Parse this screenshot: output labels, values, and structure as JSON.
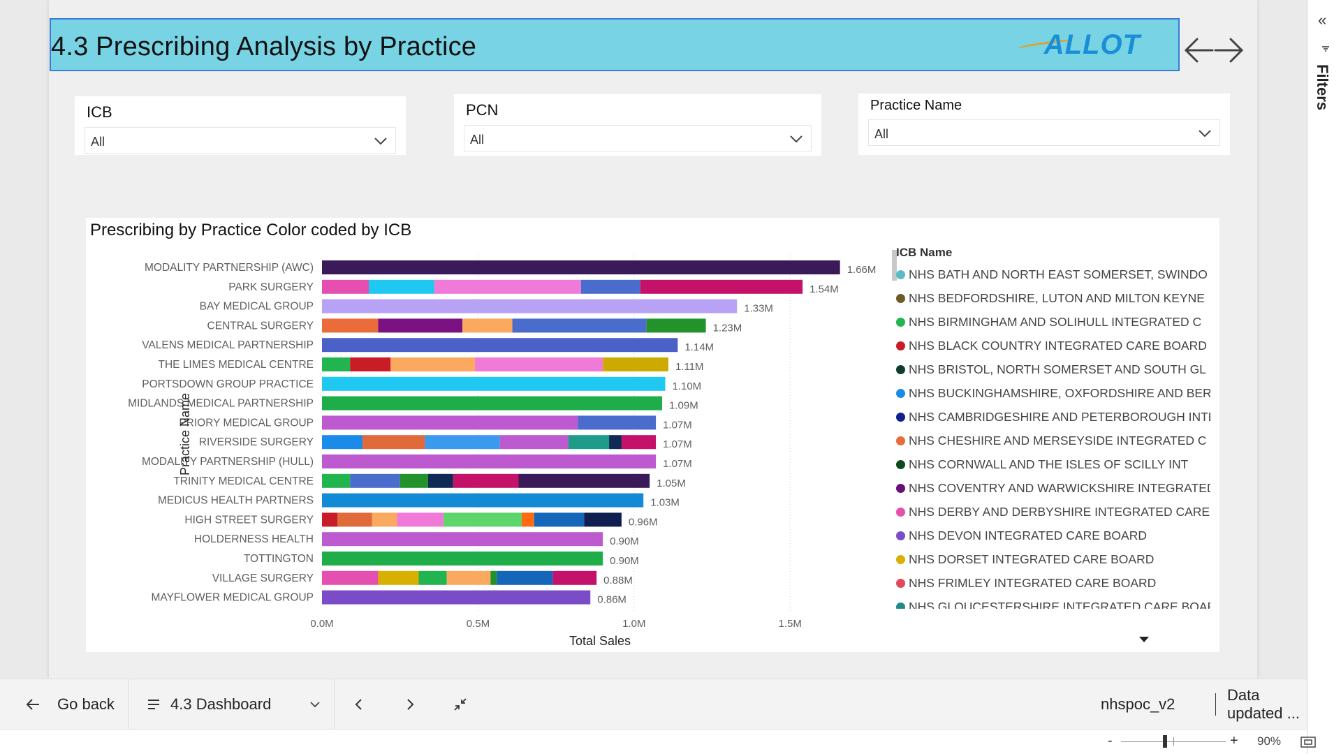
{
  "page_title": "4.3 Prescribing Analysis by Practice",
  "logo_text": "ALLOT",
  "slicers": [
    {
      "label": "ICB",
      "value": "All"
    },
    {
      "label": "PCN",
      "value": "All"
    },
    {
      "label": "Practice Name",
      "value": "All"
    }
  ],
  "chart_data": {
    "type": "bar",
    "orientation": "horizontal",
    "stacked": true,
    "title": "Prescribing by Practice Color coded by ICB",
    "xlabel": "Total Sales",
    "ylabel": "Practice Name",
    "xlim": [
      0,
      1.66
    ],
    "x_ticks": [
      "0.0M",
      "0.5M",
      "1.0M",
      "1.5M"
    ],
    "x_tick_values": [
      0,
      0.5,
      1.0,
      1.5
    ],
    "units": "M",
    "legend_title": "ICB Name",
    "legend_position": "right",
    "bars": [
      {
        "name": "MODALITY PARTNERSHIP (AWC)",
        "total": 1.66,
        "label": "1.66M",
        "segments": [
          {
            "color": "#3b1a5a",
            "value": 1.66
          }
        ]
      },
      {
        "name": "PARK SURGERY",
        "total": 1.54,
        "label": "1.54M",
        "segments": [
          {
            "color": "#e44fb0",
            "value": 0.15
          },
          {
            "color": "#1ec8f0",
            "value": 0.21
          },
          {
            "color": "#f07ad8",
            "value": 0.47
          },
          {
            "color": "#4a6ccc",
            "value": 0.19
          },
          {
            "color": "#c4126a",
            "value": 0.52
          }
        ]
      },
      {
        "name": "BAY MEDICAL GROUP",
        "total": 1.33,
        "label": "1.33M",
        "segments": [
          {
            "color": "#b7a2f6",
            "value": 1.33
          }
        ]
      },
      {
        "name": "CENTRAL SURGERY",
        "total": 1.23,
        "label": "1.23M",
        "segments": [
          {
            "color": "#ea6c3a",
            "value": 0.18
          },
          {
            "color": "#7a1282",
            "value": 0.27
          },
          {
            "color": "#fba95e",
            "value": 0.16
          },
          {
            "color": "#4a6ccc",
            "value": 0.43
          },
          {
            "color": "#24922a",
            "value": 0.19
          }
        ]
      },
      {
        "name": "VALENS MEDICAL PARTNERSHIP",
        "total": 1.14,
        "label": "1.14M",
        "segments": [
          {
            "color": "#4a62c8",
            "value": 1.14
          }
        ]
      },
      {
        "name": "THE LIMES MEDICAL CENTRE",
        "total": 1.11,
        "label": "1.11M",
        "segments": [
          {
            "color": "#22b44e",
            "value": 0.09
          },
          {
            "color": "#c81c26",
            "value": 0.13
          },
          {
            "color": "#fba95e",
            "value": 0.27
          },
          {
            "color": "#f07ad8",
            "value": 0.41
          },
          {
            "color": "#ccaa00",
            "value": 0.21
          }
        ]
      },
      {
        "name": "PORTSDOWN GROUP PRACTICE",
        "total": 1.1,
        "label": "1.10M",
        "segments": [
          {
            "color": "#1ec8f0",
            "value": 1.1
          }
        ]
      },
      {
        "name": "MIDLANDS MEDICAL PARTNERSHIP",
        "total": 1.09,
        "label": "1.09M",
        "segments": [
          {
            "color": "#1fad4a",
            "value": 1.09
          }
        ]
      },
      {
        "name": "PRIORY MEDICAL GROUP",
        "total": 1.07,
        "label": "1.07M",
        "segments": [
          {
            "color": "#bd5ad0",
            "value": 0.82
          },
          {
            "color": "#4a6ccc",
            "value": 0.25
          }
        ]
      },
      {
        "name": "RIVERSIDE SURGERY",
        "total": 1.07,
        "label": "1.07M",
        "segments": [
          {
            "color": "#1b8bea",
            "value": 0.13
          },
          {
            "color": "#e06a3a",
            "value": 0.2
          },
          {
            "color": "#3a9af0",
            "value": 0.24
          },
          {
            "color": "#bd5ad0",
            "value": 0.22
          },
          {
            "color": "#1f9b8a",
            "value": 0.13
          },
          {
            "color": "#0e2a55",
            "value": 0.04
          },
          {
            "color": "#c4126a",
            "value": 0.11
          }
        ]
      },
      {
        "name": "MODALITY PARTNERSHIP (HULL)",
        "total": 1.07,
        "label": "1.07M",
        "segments": [
          {
            "color": "#bd5ad0",
            "value": 1.07
          }
        ]
      },
      {
        "name": "TRINITY MEDICAL CENTRE",
        "total": 1.05,
        "label": "1.05M",
        "segments": [
          {
            "color": "#22b44e",
            "value": 0.09
          },
          {
            "color": "#4a6ccc",
            "value": 0.16
          },
          {
            "color": "#24922a",
            "value": 0.09
          },
          {
            "color": "#0e2a55",
            "value": 0.08
          },
          {
            "color": "#c4126a",
            "value": 0.21
          },
          {
            "color": "#3b1a5a",
            "value": 0.42
          }
        ]
      },
      {
        "name": "MEDICUS HEALTH PARTNERS",
        "total": 1.03,
        "label": "1.03M",
        "segments": [
          {
            "color": "#128ad6",
            "value": 1.03
          }
        ]
      },
      {
        "name": "HIGH STREET SURGERY",
        "total": 0.96,
        "label": "0.96M",
        "segments": [
          {
            "color": "#c81c26",
            "value": 0.05
          },
          {
            "color": "#e06a3a",
            "value": 0.11
          },
          {
            "color": "#fba95e",
            "value": 0.08
          },
          {
            "color": "#f07ad8",
            "value": 0.15
          },
          {
            "color": "#5cd66a",
            "value": 0.25
          },
          {
            "color": "#ff6a10",
            "value": 0.04
          },
          {
            "color": "#1466b8",
            "value": 0.16
          },
          {
            "color": "#0e1f50",
            "value": 0.12
          }
        ]
      },
      {
        "name": "HOLDERNESS HEALTH",
        "total": 0.9,
        "label": "0.90M",
        "segments": [
          {
            "color": "#bd5ad0",
            "value": 0.9
          }
        ]
      },
      {
        "name": "TOTTINGTON",
        "total": 0.9,
        "label": "0.90M",
        "segments": [
          {
            "color": "#1fad4a",
            "value": 0.9
          }
        ]
      },
      {
        "name": "VILLAGE SURGERY",
        "total": 0.88,
        "label": "0.88M",
        "segments": [
          {
            "color": "#e44fb0",
            "value": 0.18
          },
          {
            "color": "#d8b000",
            "value": 0.13
          },
          {
            "color": "#22b44e",
            "value": 0.09
          },
          {
            "color": "#fba95e",
            "value": 0.14
          },
          {
            "color": "#24922a",
            "value": 0.02
          },
          {
            "color": "#1466b8",
            "value": 0.18
          },
          {
            "color": "#c4126a",
            "value": 0.14
          }
        ]
      },
      {
        "name": "MAYFLOWER MEDICAL GROUP",
        "total": 0.86,
        "label": "0.86M",
        "segments": [
          {
            "color": "#7a4cc8",
            "value": 0.86
          }
        ]
      }
    ],
    "legend": [
      {
        "name": "NHS BATH AND NORTH EAST SOMERSET, SWINDO",
        "color": "#5bbcc8"
      },
      {
        "name": "NHS BEDFORDSHIRE, LUTON AND MILTON KEYNE",
        "color": "#6e5a2a"
      },
      {
        "name": "NHS BIRMINGHAM AND SOLIHULL INTEGRATED C",
        "color": "#22b44e"
      },
      {
        "name": "NHS BLACK COUNTRY INTEGRATED CARE BOARD",
        "color": "#c81c26"
      },
      {
        "name": "NHS BRISTOL, NORTH SOMERSET AND SOUTH GL",
        "color": "#0e3d2e"
      },
      {
        "name": "NHS BUCKINGHAMSHIRE, OXFORDSHIRE AND BER",
        "color": "#1b8bea"
      },
      {
        "name": "NHS CAMBRIDGESHIRE AND PETERBOROUGH INTE",
        "color": "#10208e"
      },
      {
        "name": "NHS CHESHIRE AND MERSEYSIDE INTEGRATED C",
        "color": "#ea6c3a"
      },
      {
        "name": "NHS CORNWALL AND THE ISLES OF SCILLY INT",
        "color": "#0d4a1c"
      },
      {
        "name": "NHS COVENTRY AND WARWICKSHIRE INTEGRATED",
        "color": "#6a0f7a"
      },
      {
        "name": "NHS DERBY AND DERBYSHIRE INTEGRATED CARE",
        "color": "#e44fb0"
      },
      {
        "name": "NHS DEVON INTEGRATED CARE BOARD",
        "color": "#7a4cc8"
      },
      {
        "name": "NHS DORSET INTEGRATED CARE BOARD",
        "color": "#d8b000"
      },
      {
        "name": "NHS FRIMLEY INTEGRATED CARE BOARD",
        "color": "#e04a5a"
      },
      {
        "name": "NHS GLOUCESTERSHIRE INTEGRATED CARE BOAR",
        "color": "#1f8a8a"
      }
    ]
  },
  "filters_pane": {
    "label": "Filters"
  },
  "bottom_bar": {
    "go_back": "Go back",
    "page_name": "4.3 Dashboard",
    "dataset": "nhspoc_v2",
    "data_updated": "Data updated ..."
  },
  "status_bar": {
    "zoom": "90%",
    "zoom_minus": "-",
    "zoom_plus": "+",
    "zoom_level": 0.9
  },
  "icons": [
    "arrow-left-icon",
    "arrow-right-icon",
    "chevron-down-icon",
    "back-arrow-icon",
    "page-list-icon",
    "prev-page-icon",
    "next-page-icon",
    "collapse-icon",
    "fit-page-icon",
    "filter-icon",
    "double-chevron-left-icon"
  ]
}
